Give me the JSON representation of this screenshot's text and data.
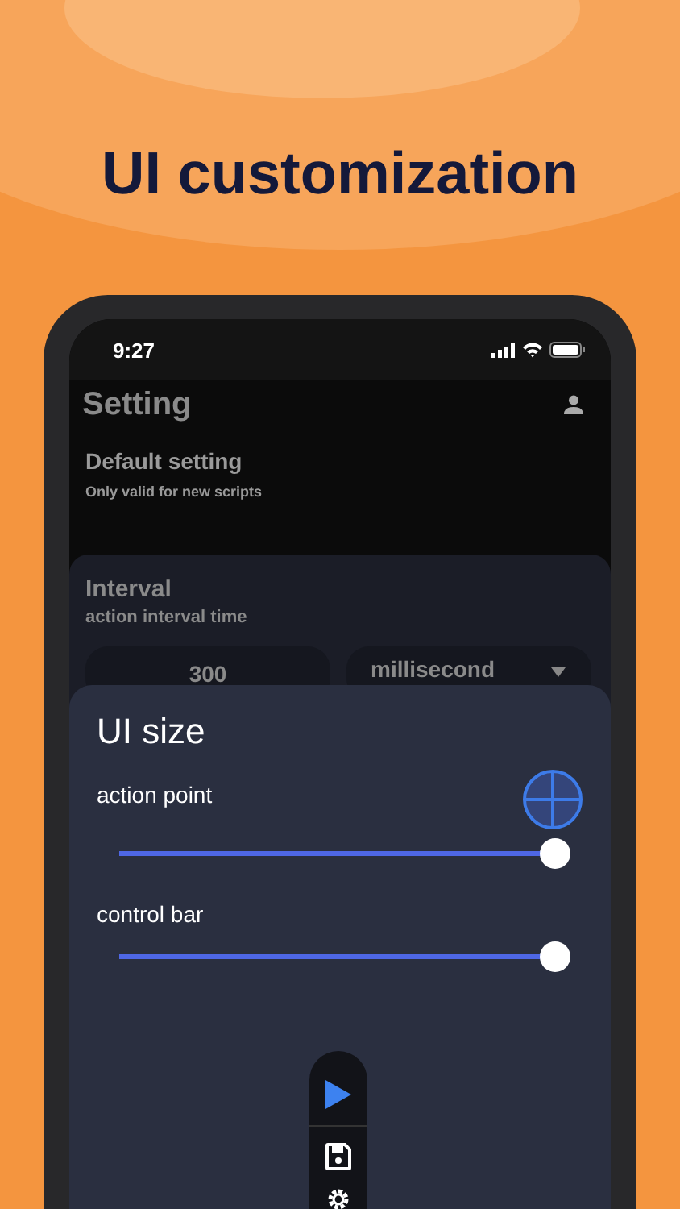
{
  "headline": "UI customization",
  "status_bar": {
    "time": "9:27"
  },
  "header": {
    "title": "Setting"
  },
  "default_setting": {
    "title": "Default setting",
    "subtitle": "Only valid for new scripts"
  },
  "interval": {
    "title": "Interval",
    "subtitle": "action interval time",
    "value": "300",
    "unit": "millisecond"
  },
  "ui_size": {
    "title": "UI size",
    "sliders": [
      {
        "kind": "preview",
        "label": "action point",
        "level": 1
      },
      {
        "kind": "plain",
        "label": "control bar",
        "level": 1
      }
    ]
  }
}
